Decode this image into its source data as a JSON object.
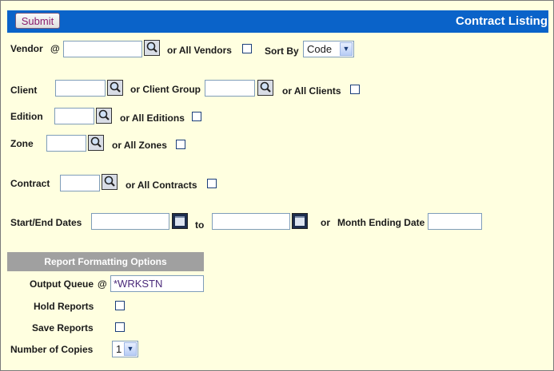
{
  "header": {
    "submit_label": "Submit",
    "title": "Contract Listing"
  },
  "vendor": {
    "label": "Vendor",
    "at": "@",
    "value": "",
    "all_label": "or All Vendors",
    "all_checked": false,
    "sort_label": "Sort By",
    "sort_value": "Code"
  },
  "client": {
    "label": "Client",
    "value": "",
    "group_label": "or Client Group",
    "group_value": "",
    "all_label": "or All Clients",
    "all_checked": false
  },
  "edition": {
    "label": "Edition",
    "value": "",
    "all_label": "or All Editions",
    "all_checked": false
  },
  "zone": {
    "label": "Zone",
    "value": "",
    "all_label": "or All Zones",
    "all_checked": false
  },
  "contract": {
    "label": "Contract",
    "value": "",
    "all_label": "or All Contracts",
    "all_checked": false
  },
  "dates": {
    "label": "Start/End Dates",
    "start": "",
    "to_label": "to",
    "end": "",
    "or_label": "or",
    "month_label": "Month Ending Date",
    "month_value": ""
  },
  "report": {
    "section_title": "Report Formatting Options",
    "output_queue_label": "Output Queue",
    "at": "@",
    "output_queue_value": "*WRKSTN",
    "hold_label": "Hold Reports",
    "hold_checked": false,
    "save_label": "Save Reports",
    "save_checked": false,
    "copies_label": "Number of Copies",
    "copies_value": "1"
  },
  "icons": {
    "lookup": "magnifier-icon",
    "calendar": "calendar-icon",
    "dropdown": "chevron-down-icon"
  }
}
